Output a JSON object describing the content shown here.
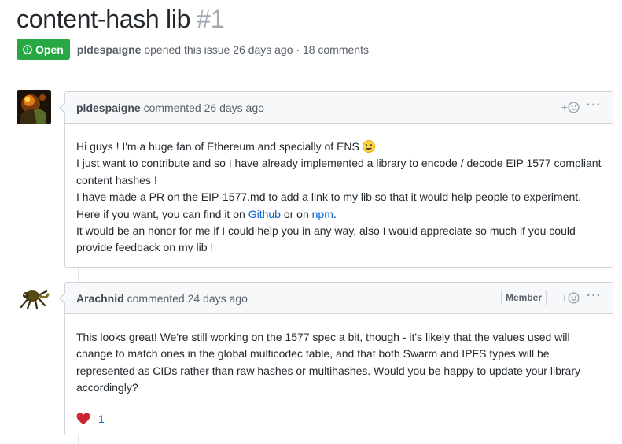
{
  "issue": {
    "title": "content-hash lib",
    "number": "#1",
    "state": "Open",
    "author": "pldespaigne",
    "meta_text": "opened this issue 26 days ago · 18 comments"
  },
  "comments": [
    {
      "author": "pldespaigne",
      "header_text": "commented 26 days ago",
      "reaction_add_label": "+",
      "body": {
        "line1": "Hi guys ! I'm a huge fan of Ethereum and specially of ENS",
        "line2": "I just want to contribute and so I have already implemented a library to encode / decode EIP 1577 compliant content hashes !",
        "line3": "I have made a PR on the EIP-1577.md to add a link to my lib so that it would help people to experiment.",
        "line4_pre": "Here if you want, you can find it on ",
        "link_github": "Github",
        "line4_mid": " or on ",
        "link_npm": "npm",
        "line4_post": ".",
        "line5": "It would be an honor for me if I could help you in any way, also I would appreciate so much if you could provide feedback on my lib !"
      }
    },
    {
      "author": "Arachnid",
      "header_text": "commented 24 days ago",
      "badge": "Member",
      "reaction_add_label": "+",
      "body": "This looks great! We're still working on the 1577 spec a bit, though - it's likely that the values used will change to match ones in the global multicodec table, and that both Swarm and IPFS types will be represented as CIDs rather than raw hashes or multihashes. Would you be happy to update your library accordingly?",
      "reactions": [
        {
          "emoji": "❤️",
          "count": "1"
        }
      ]
    }
  ],
  "colors": {
    "open_green": "#28a745",
    "link_blue": "#0366d6",
    "heart_red": "#cb2431"
  },
  "icons": [
    "issue-opened-icon",
    "smiley-icon",
    "heart-icon",
    "kebab-icon"
  ]
}
